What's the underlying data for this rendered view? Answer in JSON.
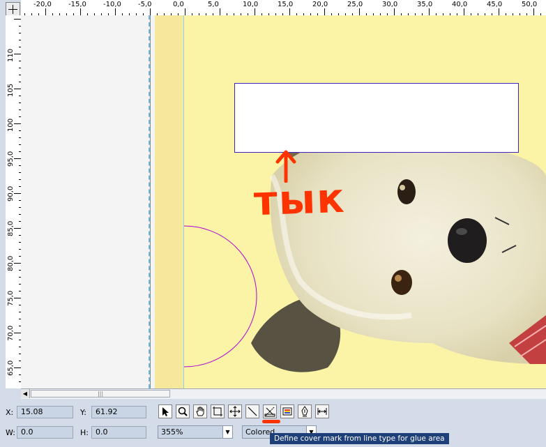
{
  "rulers": {
    "horizontal_labels": [
      "-20,0",
      "-15,0",
      "-10,0",
      "-5,0",
      "0,0",
      "5,0",
      "10,0",
      "15,0",
      "20,0",
      "25,0",
      "30,0",
      "35,0",
      "40,0",
      "45,0",
      "50,0"
    ],
    "vertical_labels": [
      "110",
      "105",
      "100",
      "95,0",
      "90,0",
      "85,0",
      "80,0",
      "75,0",
      "70,0",
      "65,0"
    ]
  },
  "canvas": {
    "page_color": "#fbf3a6",
    "glue_box_border": "#3c22c4",
    "guide_color": "#66bde0"
  },
  "annotation": {
    "text": "тык",
    "color": "#ff3300"
  },
  "status": {
    "x_label": "X:",
    "x_value": "15.08",
    "y_label": "Y:",
    "y_value": "61.92",
    "w_label": "W:",
    "w_value": "0.0",
    "h_label": "H:",
    "h_value": "0.0",
    "zoom_value": "355%",
    "mode_value": "Colored"
  },
  "toolbar": {
    "tools": [
      {
        "name": "select-tool",
        "icon": "arrow-pointer-icon"
      },
      {
        "name": "zoom-tool",
        "icon": "magnifier-icon"
      },
      {
        "name": "pan-tool",
        "icon": "hand-icon"
      },
      {
        "name": "crop-tool",
        "icon": "crop-frame-icon"
      },
      {
        "name": "move-tool",
        "icon": "move-cross-icon"
      },
      {
        "name": "line-tool",
        "icon": "diagonal-line-icon"
      },
      {
        "name": "cover-mark-tool",
        "icon": "cover-mark-icon"
      },
      {
        "name": "color-tool",
        "icon": "color-swatch-icon"
      },
      {
        "name": "pen-tool",
        "icon": "pen-nib-icon"
      },
      {
        "name": "measure-tool",
        "icon": "measure-arrows-icon"
      }
    ],
    "tooltip": "Define cover mark from line type for glue area"
  }
}
